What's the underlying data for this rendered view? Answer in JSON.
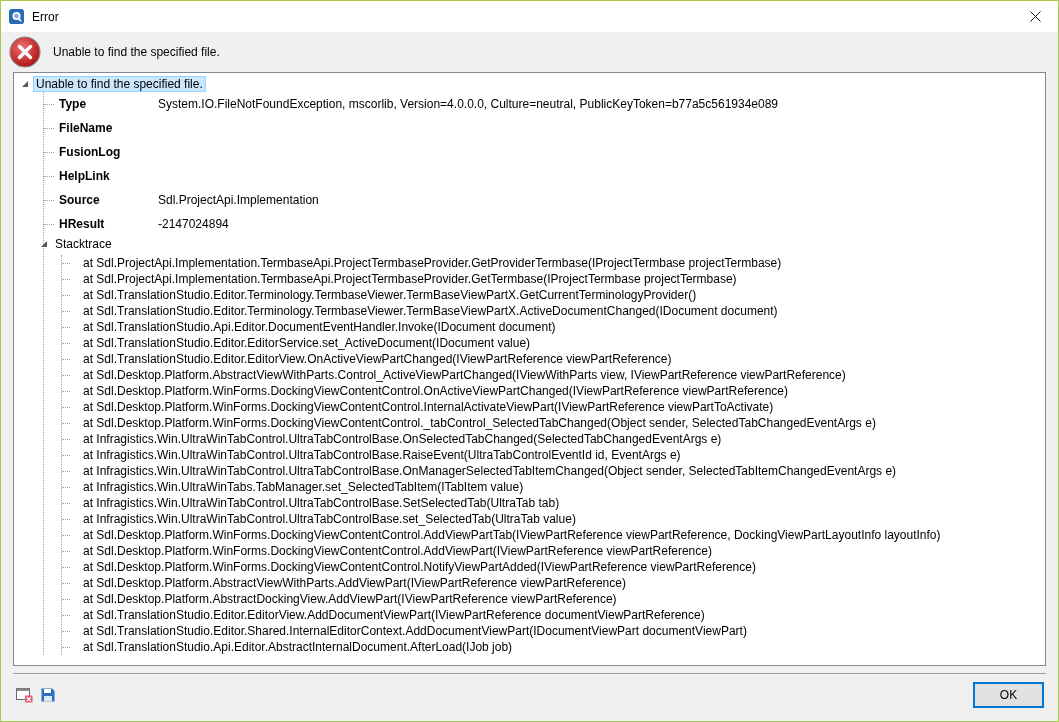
{
  "window": {
    "title": "Error"
  },
  "message": "Unable to find the specified file.",
  "tree": {
    "label": "Unable to find the specified file.",
    "expanded": true,
    "selected": true,
    "children": [
      {
        "kind": "property",
        "name": "Type",
        "value": "System.IO.FileNotFoundException, mscorlib, Version=4.0.0.0, Culture=neutral, PublicKeyToken=b77a5c561934e089"
      },
      {
        "kind": "property",
        "name": "FileName"
      },
      {
        "kind": "property",
        "name": "FusionLog"
      },
      {
        "kind": "property",
        "name": "HelpLink"
      },
      {
        "kind": "property",
        "name": "Source",
        "value": "Sdl.ProjectApi.Implementation"
      },
      {
        "kind": "property",
        "name": "HResult",
        "value": "-2147024894"
      },
      {
        "kind": "group",
        "label": "Stacktrace",
        "expanded": true,
        "selected": false,
        "children": [
          "at Sdl.ProjectApi.Implementation.TermbaseApi.ProjectTermbaseProvider.GetProviderTermbase(IProjectTermbase projectTermbase)",
          "at Sdl.ProjectApi.Implementation.TermbaseApi.ProjectTermbaseProvider.GetTermbase(IProjectTermbase projectTermbase)",
          "at Sdl.TranslationStudio.Editor.Terminology.TermbaseViewer.TermBaseViewPartX.GetCurrentTerminologyProvider()",
          "at Sdl.TranslationStudio.Editor.Terminology.TermbaseViewer.TermBaseViewPartX.ActiveDocumentChanged(IDocument document)",
          "at Sdl.TranslationStudio.Api.Editor.DocumentEventHandler.Invoke(IDocument document)",
          "at Sdl.TranslationStudio.Editor.EditorService.set_ActiveDocument(IDocument value)",
          "at Sdl.TranslationStudio.Editor.EditorView.OnActiveViewPartChanged(IViewPartReference viewPartReference)",
          "at Sdl.Desktop.Platform.AbstractViewWithParts.Control_ActiveViewPartChanged(IViewWithParts view, IViewPartReference viewPartReference)",
          "at Sdl.Desktop.Platform.WinForms.DockingViewContentControl.OnActiveViewPartChanged(IViewPartReference viewPartReference)",
          "at Sdl.Desktop.Platform.WinForms.DockingViewContentControl.InternalActivateViewPart(IViewPartReference viewPartToActivate)",
          "at Sdl.Desktop.Platform.WinForms.DockingViewContentControl._tabControl_SelectedTabChanged(Object sender, SelectedTabChangedEventArgs e)",
          "at Infragistics.Win.UltraWinTabControl.UltraTabControlBase.OnSelectedTabChanged(SelectedTabChangedEventArgs e)",
          "at Infragistics.Win.UltraWinTabControl.UltraTabControlBase.RaiseEvent(UltraTabControlEventId id, EventArgs e)",
          "at Infragistics.Win.UltraWinTabControl.UltraTabControlBase.OnManagerSelectedTabItemChanged(Object sender, SelectedTabItemChangedEventArgs e)",
          "at Infragistics.Win.UltraWinTabs.TabManager.set_SelectedTabItem(ITabItem value)",
          "at Infragistics.Win.UltraWinTabControl.UltraTabControlBase.SetSelectedTab(UltraTab tab)",
          "at Infragistics.Win.UltraWinTabControl.UltraTabControlBase.set_SelectedTab(UltraTab value)",
          "at Sdl.Desktop.Platform.WinForms.DockingViewContentControl.AddViewPartTab(IViewPartReference viewPartReference, DockingViewPartLayoutInfo layoutInfo)",
          "at Sdl.Desktop.Platform.WinForms.DockingViewContentControl.AddViewPart(IViewPartReference viewPartReference)",
          "at Sdl.Desktop.Platform.WinForms.DockingViewContentControl.NotifyViewPartAdded(IViewPartReference viewPartReference)",
          "at Sdl.Desktop.Platform.AbstractViewWithParts.AddViewPart(IViewPartReference viewPartReference)",
          "at Sdl.Desktop.Platform.AbstractDockingView.AddViewPart(IViewPartReference viewPartReference)",
          "at Sdl.TranslationStudio.Editor.EditorView.AddDocumentViewPart(IViewPartReference documentViewPartReference)",
          "at Sdl.TranslationStudio.Editor.Shared.InternalEditorContext.AddDocumentViewPart(IDocumentViewPart documentViewPart)",
          "at Sdl.TranslationStudio.Api.Editor.AbstractInternalDocument.AfterLoad(IJob job)"
        ]
      }
    ]
  },
  "buttons": [
    {
      "label": "OK"
    }
  ]
}
